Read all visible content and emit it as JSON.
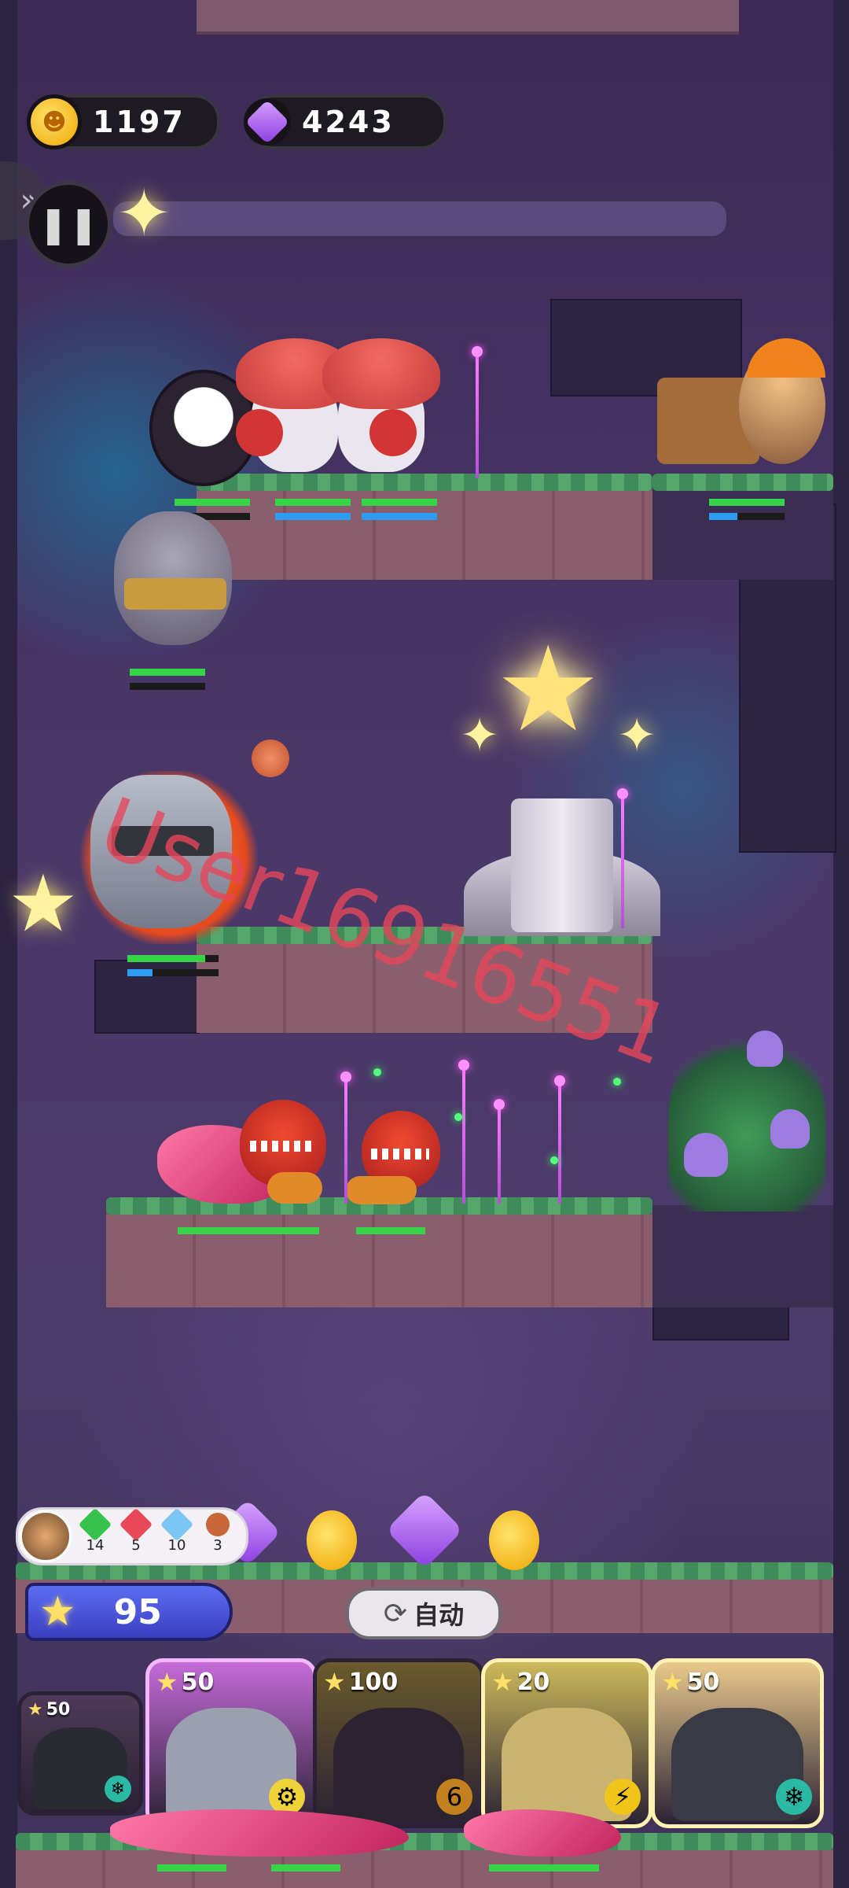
{
  "hud": {
    "gold_amount": "1197",
    "gem_amount": "4243",
    "gold_icon": "gold-coin-icon",
    "gem_icon": "purple-gem-icon",
    "pause_icon": "pause-icon",
    "side_tab_icon": "double-chevron-icon",
    "wave_progress": 0
  },
  "watermark": "User16916551",
  "resources": {
    "items": [
      {
        "name": "green-gem-icon",
        "color": "#36c24c",
        "count": "14"
      },
      {
        "name": "red-gem-icon",
        "color": "#e8495a",
        "count": "5"
      },
      {
        "name": "blue-gem-icon",
        "color": "#7bc6f2",
        "count": "10"
      },
      {
        "name": "meat-icon",
        "color": "#c9673a",
        "count": "3"
      }
    ]
  },
  "energy": {
    "value": "95"
  },
  "auto_button": {
    "label": "自动"
  },
  "cards": [
    {
      "name": "card-penguin-chef-small",
      "cost": "50",
      "bg": "#4d3a58",
      "elem_color": "#2ab9a4",
      "elem_glyph": "❄"
    },
    {
      "name": "card-knight",
      "cost": "50",
      "bg": "#c46ad8",
      "elem_color": "#f0d23a",
      "elem_glyph": "⚙"
    },
    {
      "name": "card-panda-warrior",
      "cost": "100",
      "bg": "#6b5a2c",
      "elem_color": "#c4801e",
      "elem_glyph": "6"
    },
    {
      "name": "card-hamster-armor",
      "cost": "20",
      "bg": "#cdb95a",
      "elem_color": "#f0c51a",
      "elem_glyph": "⚡"
    },
    {
      "name": "card-penguin-chef",
      "cost": "50",
      "bg": "#e9c98c",
      "elem_color": "#2ab9a4",
      "elem_glyph": "❄"
    }
  ]
}
